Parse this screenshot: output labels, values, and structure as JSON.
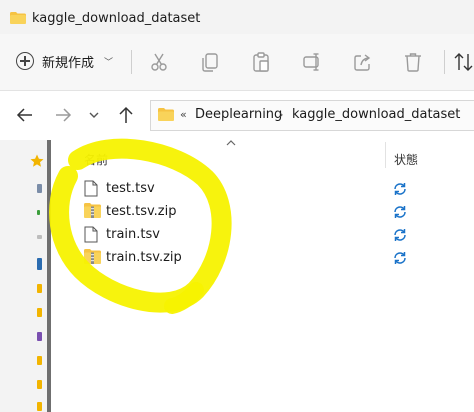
{
  "window": {
    "title": "kaggle_download_dataset"
  },
  "toolbar": {
    "new_label": "新規作成",
    "icons": [
      "cut-icon",
      "copy-icon",
      "paste-icon",
      "rename-icon",
      "share-icon",
      "delete-icon",
      "sort-icon"
    ]
  },
  "address": {
    "overflow": "«",
    "segments": [
      "Deeplearning",
      "kaggle_download_dataset"
    ],
    "separator": "›"
  },
  "columns": {
    "name": "名前",
    "status": "状態"
  },
  "files": [
    {
      "name": "test.tsv",
      "type": "file"
    },
    {
      "name": "test.tsv.zip",
      "type": "zip"
    },
    {
      "name": "train.tsv",
      "type": "file"
    },
    {
      "name": "train.tsv.zip",
      "type": "zip"
    }
  ],
  "colors": {
    "highlight": "#f7f200",
    "sync": "#1a73c9",
    "folder": "#f6c343"
  }
}
